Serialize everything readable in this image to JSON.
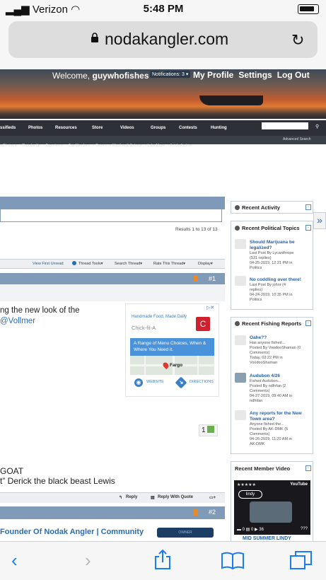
{
  "status": {
    "carrier": "Verizon",
    "time": "5:48 PM"
  },
  "browser": {
    "domain": "nodakangler.com"
  },
  "header": {
    "welcome_prefix": "Welcome,",
    "username": "guywhofishes",
    "notifications": "Notifications: 3 ▾",
    "links": [
      "My Profile",
      "Settings",
      "Log Out"
    ]
  },
  "nav": {
    "items": [
      "ssifieds",
      "Photos",
      "Resources",
      "Store",
      "Videos",
      "Groups",
      "Contests",
      "Hunting"
    ],
    "sub_items": [
      "n Photos ▾",
      "• Thumbs Up",
      "• Experience",
      "• Top Members",
      "• Games",
      "• Weather & Solunar",
      "• Lake Maps",
      "• Article Archive"
    ],
    "advanced_search": "Advanced Search"
  },
  "thread": {
    "results": "Results 1 to 13 of 13",
    "tools": [
      "View First Unread",
      "Thread Tools▾",
      "Search Thread▾",
      "Rate This Thread▾",
      "Display▾"
    ],
    "post1": {
      "number": "#1",
      "line1": "ng the new look of the",
      "line2_mention": "@Vollmer",
      "likes": "1",
      "sig_line1": "GOAT",
      "sig_line2": "t” Derick the black beast Lewis",
      "actions": [
        "Reply",
        "Reply With Quote"
      ]
    },
    "post2": {
      "number": "#2",
      "title": "Founder Of Nodak Angler | Community",
      "badge": "OWNER"
    }
  },
  "ad": {
    "tagline": "Handmade Food, Made Daily",
    "brand": "Chick-fil-A",
    "blurb": "A Range of Menu Choices, When & Where You Need it.",
    "map_label": "Fargo",
    "website": "WEBSITE",
    "directions": "DIRECTIONS"
  },
  "sidebar": {
    "recent_activity": "Recent Activity",
    "political": {
      "title": "Recent Political Topics",
      "items": [
        {
          "title": "Should Marijuana be legalized?",
          "meta1": "Last Post By Lycanthrope",
          "meta2": "(531 replies)",
          "meta3": "04-25-2019, 12:21 PM in",
          "forum": "Politics"
        },
        {
          "title": "No coddling over there!",
          "meta1": "Last Post By johnr (4",
          "meta2": "replies)",
          "meta3": "04-24-2019, 10:35 PM in",
          "forum": "Politics"
        }
      ]
    },
    "fishing": {
      "title": "Recent Fishing Reports",
      "items": [
        {
          "title": "Oahe??",
          "meta1": "Has anyone fished...",
          "meta2": "Posted By VoodooShaman (0",
          "meta3": "Comments)",
          "meta4": "Today, 03:22 PM in",
          "forum": "VoodooShaman"
        },
        {
          "title": "Audubon 4/26",
          "meta1": "Fished Audubon...",
          "meta2": "Posted By ndfnfan (2",
          "meta3": "Comments)",
          "meta4": "04-27-2019, 09:40 AM in",
          "forum": "ndfnfan"
        },
        {
          "title": "Any reports for the New Town area?",
          "meta1": "Anyone fished the...",
          "meta2": "Posted By AK-DMK (5",
          "meta3": "Comments)",
          "meta4": "04-26-2019, 11:20 AM in",
          "forum": "AK-DMK"
        }
      ]
    },
    "video": {
      "title": "Recent Member Video",
      "caption": "MID SUMMER LINDY",
      "views": "36"
    }
  }
}
